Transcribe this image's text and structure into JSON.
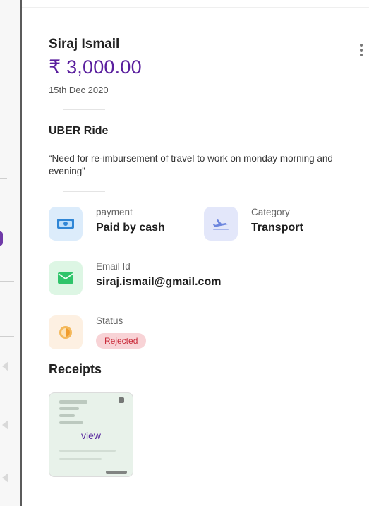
{
  "expense": {
    "employee_name": "Siraj Ismail",
    "amount": "₹ 3,000.00",
    "date": "15th Dec 2020",
    "title": "UBER Ride",
    "description": "“Need for re-imbursement of travel to  work on monday morning and evening”"
  },
  "details": {
    "payment": {
      "label": "payment",
      "value": "Paid by cash",
      "icon": "cash-icon",
      "color": "#dcecfb"
    },
    "category": {
      "label": "Category",
      "value": "Transport",
      "icon": "airplane-icon",
      "color": "#e3e7fa"
    },
    "email": {
      "label": "Email Id",
      "value": "siraj.ismail@gmail.com",
      "icon": "mail-icon",
      "color": "#ddf6e4"
    },
    "status": {
      "label": "Status",
      "value": "Rejected",
      "icon": "clock-icon",
      "color": "#fdf0e2"
    }
  },
  "receipts": {
    "title": "Receipts",
    "items": [
      {
        "view_label": "view"
      }
    ]
  },
  "colors": {
    "amount": "#5a1f9e",
    "rejected_bg": "#f8d3d6",
    "rejected_text": "#c92b3a"
  }
}
